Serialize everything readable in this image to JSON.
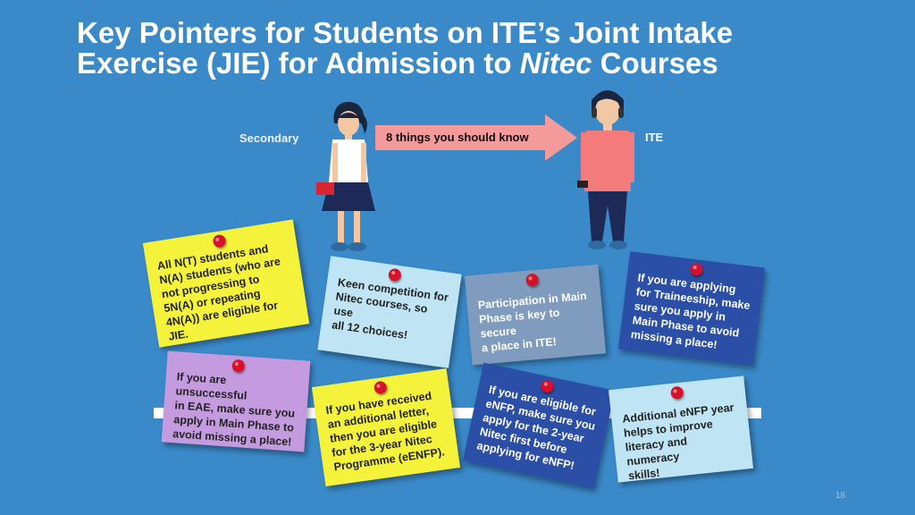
{
  "title": {
    "line1": "Key Pointers for Students on ITE’s Joint Intake",
    "line2_pre": "Exercise (JIE) for Admission to ",
    "line2_italic": "Nitec",
    "line2_post": " Courses"
  },
  "flow": {
    "from_label": "Secondary",
    "arrow_label": "8 things you should know",
    "to_label": "ITE"
  },
  "notes": [
    {
      "lines": [
        "All N(T) students and",
        "N(A) students (who are",
        "not progressing to",
        "5N(A) or repeating",
        "4N(A)) are eligible for",
        "JIE."
      ],
      "color": "#f4f23a"
    },
    {
      "lines": [
        "Keen competition for",
        "Nitec courses, so use",
        "all 12 choices!"
      ],
      "color": "#bfe4f3"
    },
    {
      "lines": [
        "Participation in Main",
        "Phase is key to secure",
        "a place in ITE!"
      ],
      "color": "#7f9bbd"
    },
    {
      "lines": [
        "If you are applying",
        "for Traineeship, make",
        "sure you apply in",
        "Main Phase to avoid",
        "missing a place!"
      ],
      "color": "#2b4ea6"
    },
    {
      "lines": [
        "If you are unsuccessful",
        "in EAE, make sure you",
        "apply in Main Phase to",
        "avoid missing a place!"
      ],
      "color": "#c59be0"
    },
    {
      "lines": [
        "If you have received",
        "an additional letter,",
        "then you are eligible",
        "for the 3-year Nitec",
        "Programme (eENFP)."
      ],
      "color": "#f4f23a"
    },
    {
      "lines": [
        "If you are eligible for",
        "eNFP, make sure you",
        "apply for the 2-year",
        "Nitec first before",
        "applying for eNFP!"
      ],
      "color": "#2b4ea6"
    },
    {
      "lines": [
        "Additional eNFP year",
        "helps to improve",
        "literacy and numeracy",
        "skills!"
      ],
      "color": "#bfe4f3"
    }
  ],
  "page_number": "18"
}
